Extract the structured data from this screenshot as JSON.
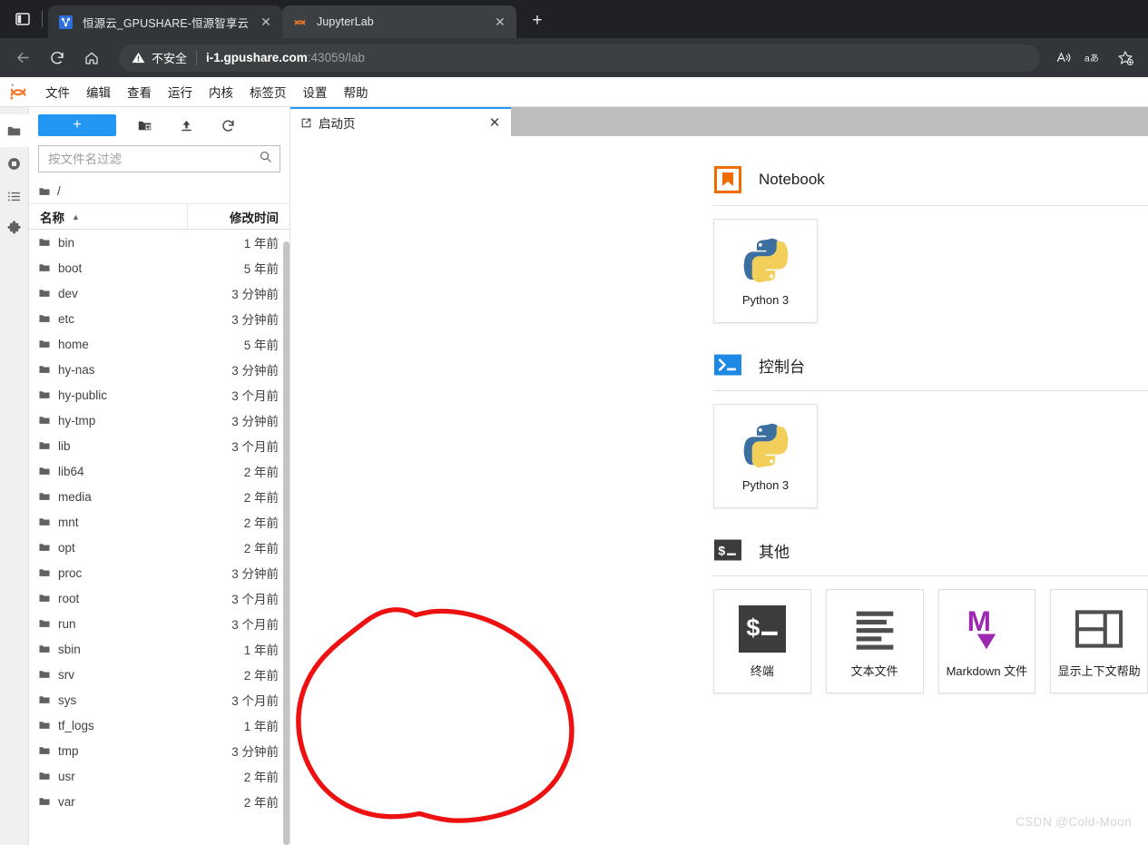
{
  "browser": {
    "tabs": [
      {
        "title": "恒源云_GPUSHARE-恒源智享云",
        "favicon": "gpushare-favicon",
        "active": false
      },
      {
        "title": "JupyterLab",
        "favicon": "jupyter-favicon",
        "active": true
      }
    ],
    "new_tab_label": "+",
    "close_label": "✕",
    "nav": {
      "back": "back-arrow",
      "reload": "reload-icon",
      "home": "home-icon"
    },
    "omnibox": {
      "security_label": "不安全",
      "security_icon": "warning-triangle-icon",
      "url_host": "i-1.gpushare.com",
      "url_rest": ":43059/lab"
    },
    "toolbar_icons": [
      "read-aloud-icon",
      "translate-icon",
      "favorites-icon"
    ]
  },
  "jupyter": {
    "logo": "jupyter-logo",
    "menu": [
      {
        "label": "文件"
      },
      {
        "label": "编辑"
      },
      {
        "label": "查看"
      },
      {
        "label": "运行"
      },
      {
        "label": "内核"
      },
      {
        "label": "标签页"
      },
      {
        "label": "设置"
      },
      {
        "label": "帮助"
      }
    ],
    "activity_bar": [
      {
        "icon": "file-browser-icon",
        "active": true
      },
      {
        "icon": "running-kernels-icon",
        "active": false
      },
      {
        "icon": "commands-list-icon",
        "active": false
      },
      {
        "icon": "extensions-puzzle-icon",
        "active": false
      }
    ],
    "file_browser": {
      "new_launcher_label": "+",
      "tools": [
        {
          "icon": "new-folder-icon"
        },
        {
          "icon": "upload-icon"
        },
        {
          "icon": "refresh-icon"
        }
      ],
      "filter_placeholder": "按文件名过滤",
      "filter_value": "",
      "search_icon": "search-icon",
      "breadcrumb": "/",
      "columns": {
        "name": "名称",
        "modified": "修改时间",
        "sort_direction": "▲"
      },
      "items": [
        {
          "name": "bin",
          "modified": "1 年前"
        },
        {
          "name": "boot",
          "modified": "5 年前"
        },
        {
          "name": "dev",
          "modified": "3 分钟前"
        },
        {
          "name": "etc",
          "modified": "3 分钟前"
        },
        {
          "name": "home",
          "modified": "5 年前"
        },
        {
          "name": "hy-nas",
          "modified": "3 分钟前"
        },
        {
          "name": "hy-public",
          "modified": "3 个月前"
        },
        {
          "name": "hy-tmp",
          "modified": "3 分钟前"
        },
        {
          "name": "lib",
          "modified": "3 个月前"
        },
        {
          "name": "lib64",
          "modified": "2 年前"
        },
        {
          "name": "media",
          "modified": "2 年前"
        },
        {
          "name": "mnt",
          "modified": "2 年前"
        },
        {
          "name": "opt",
          "modified": "2 年前"
        },
        {
          "name": "proc",
          "modified": "3 分钟前"
        },
        {
          "name": "root",
          "modified": "3 个月前"
        },
        {
          "name": "run",
          "modified": "3 个月前"
        },
        {
          "name": "sbin",
          "modified": "1 年前"
        },
        {
          "name": "srv",
          "modified": "2 年前"
        },
        {
          "name": "sys",
          "modified": "3 个月前"
        },
        {
          "name": "tf_logs",
          "modified": "1 年前"
        },
        {
          "name": "tmp",
          "modified": "3 分钟前"
        },
        {
          "name": "usr",
          "modified": "2 年前"
        },
        {
          "name": "var",
          "modified": "2 年前"
        }
      ]
    },
    "doc_tab": {
      "label": "启动页",
      "icon": "launcher-icon",
      "close": "✕"
    },
    "launcher": {
      "sections": [
        {
          "title": "Notebook",
          "icon": "notebook-bookmark-icon",
          "cards": [
            {
              "label": "Python 3",
              "icon": "python-logo-icon"
            }
          ]
        },
        {
          "title": "控制台",
          "icon": "console-prompt-icon",
          "cards": [
            {
              "label": "Python 3",
              "icon": "python-logo-icon"
            }
          ]
        },
        {
          "title": "其他",
          "icon": "terminal-dollar-icon",
          "cards": [
            {
              "label": "终端",
              "icon": "terminal-dollar-icon",
              "annotated": true
            },
            {
              "label": "文本文件",
              "icon": "text-file-icon"
            },
            {
              "label": "Markdown 文件",
              "icon": "markdown-icon"
            },
            {
              "label": "显示上下文帮助",
              "icon": "contextual-help-icon"
            }
          ]
        }
      ]
    }
  },
  "annotation": {
    "color": "#ee1111",
    "shape": "hand-drawn-circle",
    "target": "终端"
  },
  "watermark": "CSDN @Cold-Moon",
  "colors": {
    "accent_blue": "#2196f3",
    "browser_dark": "#202124",
    "tab_active": "#3c4043",
    "notebook_orange": "#ef6c00",
    "console_blue": "#1e88e5",
    "terminal_gray": "#3c3c3c",
    "markdown_purple": "#9c27b0",
    "annotation_red": "#ee1111"
  }
}
